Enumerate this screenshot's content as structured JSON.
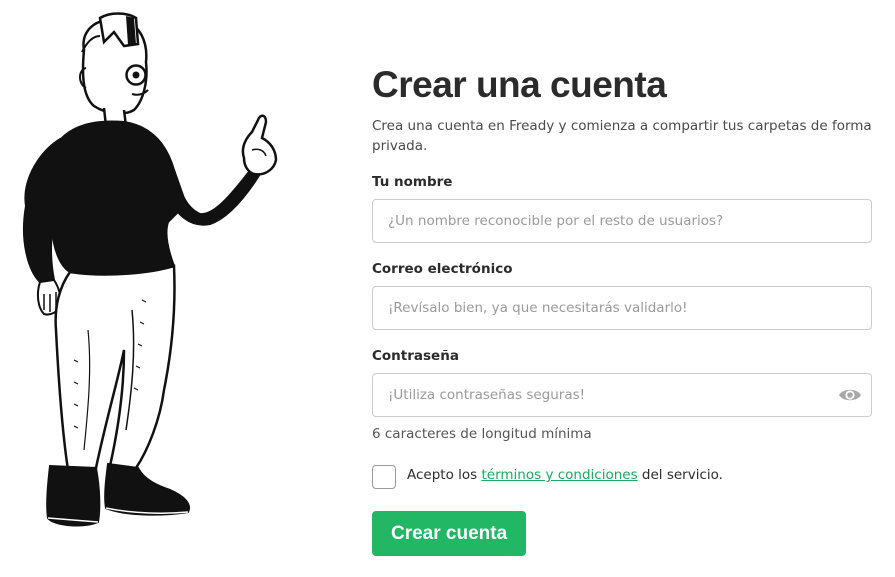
{
  "signup": {
    "title": "Crear una cuenta",
    "subtitle": "Crea una cuenta en Fready y comienza a compartir tus carpetas de forma privada.",
    "name_field": {
      "label": "Tu nombre",
      "value": "",
      "placeholder": "¿Un nombre reconocible por el resto de usuarios?"
    },
    "email_field": {
      "label": "Correo electrónico",
      "value": "",
      "placeholder": "¡Revísalo bien, ya que necesitarás validarlo!"
    },
    "password_field": {
      "label": "Contraseña",
      "value": "",
      "placeholder": "¡Utiliza contraseñas seguras!",
      "toggle_icon": "eye-icon",
      "hint": "6 caracteres de longitud mínima"
    },
    "terms": {
      "checked": false,
      "prefix": "Acepto los ",
      "link_text": "términos y condiciones",
      "suffix": " del servicio."
    },
    "submit_label": "Crear cuenta"
  },
  "illustration": {
    "icon": "person-pointing-illustration"
  },
  "colors": {
    "accent": "#21b765",
    "link": "#1aab5f",
    "border": "#cccccc",
    "text": "#2b2b2b"
  }
}
